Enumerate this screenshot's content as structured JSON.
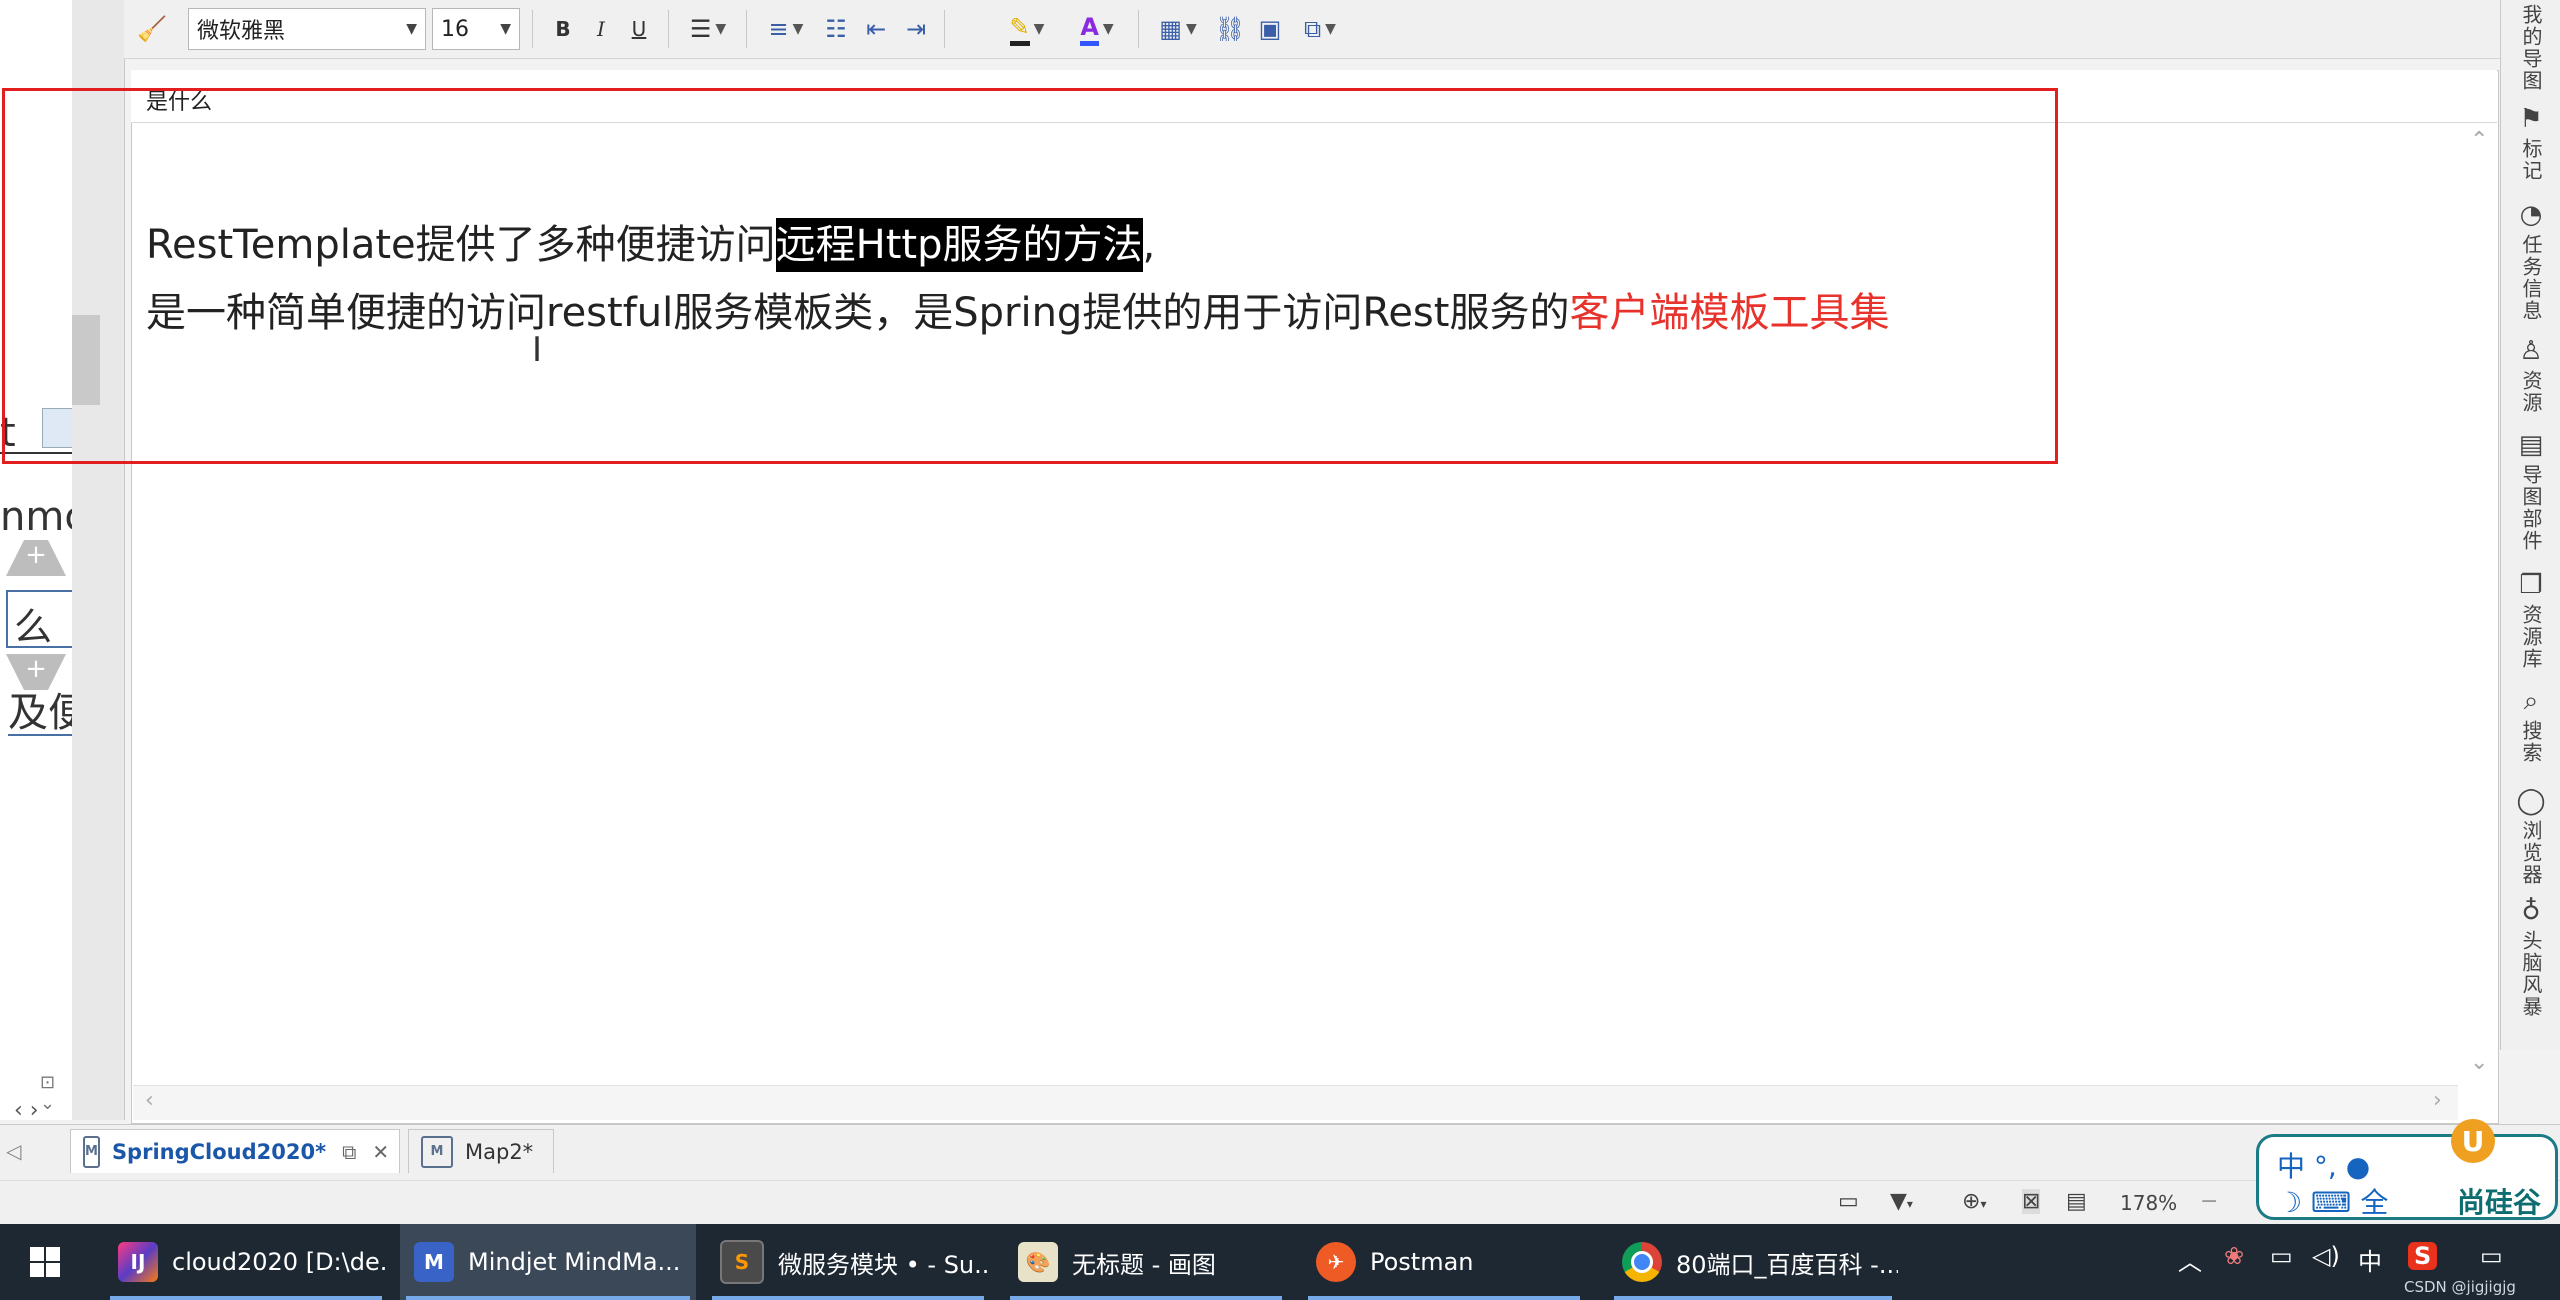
{
  "toolbar": {
    "font_name": "微软雅黑",
    "font_size": "16",
    "bold": "B",
    "italic": "I",
    "underline": "U",
    "font_color_glyph": "A"
  },
  "editor": {
    "topic_title": "是什么",
    "line1_prefix": "RestTemplate提供了多种便捷访问",
    "line1_highlight": "远程Http服务的方法",
    "line1_suffix": ",",
    "line2_prefix": "是一种简单便捷的访问restful服务模板类，是Spring提供的用于访问Rest服务的",
    "line2_red": "客户端模板工具集"
  },
  "left_fragments": [
    "t",
    "nmc",
    "么",
    "及便"
  ],
  "right_panel": [
    {
      "icon": "map-icon",
      "label": "我的导图"
    },
    {
      "icon": "marker-icon",
      "label": "标记"
    },
    {
      "icon": "task-icon",
      "label": "任务信息"
    },
    {
      "icon": "resource-icon",
      "label": "资源"
    },
    {
      "icon": "parts-icon",
      "label": "导图部件"
    },
    {
      "icon": "library-icon",
      "label": "资源库"
    },
    {
      "icon": "search-icon",
      "label": "搜索"
    },
    {
      "icon": "browser-icon",
      "label": "浏览器"
    },
    {
      "icon": "bulb-icon",
      "label": "头脑风暴"
    }
  ],
  "doc_tabs": [
    {
      "label": "SpringCloud2020*",
      "active": true
    },
    {
      "label": "Map2*",
      "active": false
    }
  ],
  "status_bar": {
    "zoom": "178%"
  },
  "ime": {
    "row1": "中 °, ●",
    "row2": "☽ ⌨ 全",
    "brand": "尚硅谷",
    "logo": "U"
  },
  "taskbar": [
    {
      "label": "cloud2020 [D:\\de...",
      "icon": "intellij-icon",
      "active": false
    },
    {
      "label": "Mindjet MindMa...",
      "icon": "mindjet-icon",
      "active": true
    },
    {
      "label": "微服务模块 • - Su...",
      "icon": "sublime-icon",
      "active": false
    },
    {
      "label": "无标题 - 画图",
      "icon": "paint-icon",
      "active": false
    },
    {
      "label": "Postman",
      "icon": "postman-icon",
      "active": false
    },
    {
      "label": "80端口_百度百科 -...",
      "icon": "chrome-icon",
      "active": false
    }
  ],
  "tray": {
    "ime_char": "中"
  },
  "watermark": "CSDN @jigjigjg"
}
